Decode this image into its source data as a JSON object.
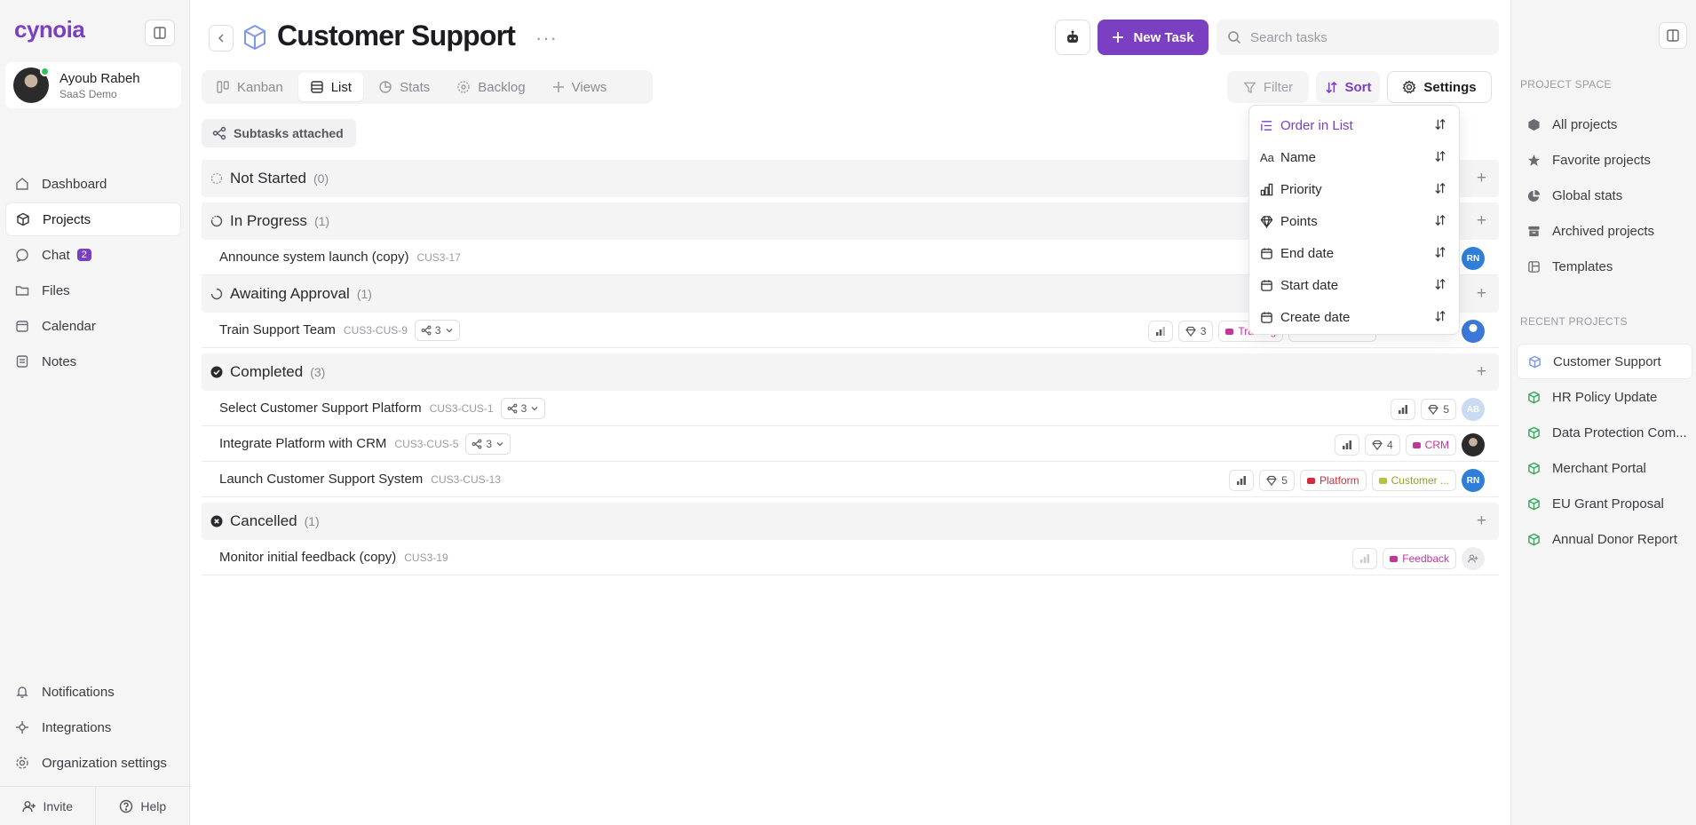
{
  "app": {
    "logo": "cynoia"
  },
  "user": {
    "name": "Ayoub Rabeh",
    "org": "SaaS Demo"
  },
  "nav": {
    "items": [
      {
        "label": "Dashboard",
        "icon": "home-icon"
      },
      {
        "label": "Projects",
        "icon": "cube-icon",
        "active": true
      },
      {
        "label": "Chat",
        "icon": "chat-icon",
        "badge": "2"
      },
      {
        "label": "Files",
        "icon": "folder-icon"
      },
      {
        "label": "Calendar",
        "icon": "calendar-icon"
      },
      {
        "label": "Notes",
        "icon": "note-icon"
      }
    ],
    "bottom": [
      {
        "label": "Notifications",
        "icon": "bell-icon"
      },
      {
        "label": "Integrations",
        "icon": "plug-icon"
      },
      {
        "label": "Organization settings",
        "icon": "gear-icon"
      }
    ],
    "invite": "Invite",
    "help": "Help"
  },
  "header": {
    "title": "Customer Support",
    "new_task": "New Task",
    "search_placeholder": "Search tasks"
  },
  "views": {
    "tabs": [
      {
        "label": "Kanban",
        "icon": "kanban-icon"
      },
      {
        "label": "List",
        "icon": "list-icon",
        "active": true
      },
      {
        "label": "Stats",
        "icon": "pie-icon"
      },
      {
        "label": "Backlog",
        "icon": "backlog-icon"
      },
      {
        "label": "Views",
        "icon": "plus-icon"
      }
    ]
  },
  "toolbar": {
    "filter": "Filter",
    "sort": "Sort",
    "settings": "Settings",
    "subtasks": "Subtasks attached"
  },
  "groups": {
    "not_started": {
      "label": "Not Started",
      "count": "(0)"
    },
    "in_progress": {
      "label": "In Progress",
      "count": "(1)"
    },
    "awaiting": {
      "label": "Awaiting Approval",
      "count": "(1)"
    },
    "completed": {
      "label": "Completed",
      "count": "(3)"
    },
    "cancelled": {
      "label": "Cancelled",
      "count": "(1)"
    }
  },
  "tasks": {
    "t1": {
      "title": "Announce system launch (copy)",
      "code": "CUS3-17",
      "avatar": "RN"
    },
    "t2": {
      "title": "Train Support Team",
      "code": "CUS3-CUS-9",
      "subtasks": "3",
      "points": "3",
      "tag": "Training",
      "tag2": "New Custo..."
    },
    "t3": {
      "title": "Select Customer Support Platform",
      "code": "CUS3-CUS-1",
      "subtasks": "3",
      "points": "5",
      "avatar": "AB"
    },
    "t4": {
      "title": "Integrate Platform with CRM",
      "code": "CUS3-CUS-5",
      "subtasks": "3",
      "points": "4",
      "tag": "CRM"
    },
    "t5": {
      "title": "Launch Customer Support System",
      "code": "CUS3-CUS-13",
      "points": "5",
      "tag": "Platform",
      "tag2": "Customer ...",
      "avatar": "RN"
    },
    "t6": {
      "title": "Monitor initial feedback (copy)",
      "code": "CUS3-19",
      "tag": "Feedback"
    }
  },
  "sort_menu": {
    "items": [
      {
        "label": "Order in List",
        "active": true
      },
      {
        "label": "Name"
      },
      {
        "label": "Priority"
      },
      {
        "label": "Points"
      },
      {
        "label": "End date"
      },
      {
        "label": "Start date"
      },
      {
        "label": "Create date"
      }
    ]
  },
  "right_panel": {
    "project_space_title": "PROJECT SPACE",
    "project_space": [
      {
        "label": "All projects"
      },
      {
        "label": "Favorite projects"
      },
      {
        "label": "Global stats"
      },
      {
        "label": "Archived projects"
      },
      {
        "label": "Templates"
      }
    ],
    "recent_title": "RECENT PROJECTS",
    "recent": [
      {
        "label": "Customer Support",
        "active": true
      },
      {
        "label": "HR Policy Update"
      },
      {
        "label": "Data Protection Com..."
      },
      {
        "label": "Merchant Portal"
      },
      {
        "label": "EU Grant Proposal"
      },
      {
        "label": "Annual Donor Report"
      }
    ]
  },
  "colors": {
    "accent": "#7b3fc1",
    "recent_icon": "#2fae5a",
    "active_project_icon": "#7f98e8"
  }
}
